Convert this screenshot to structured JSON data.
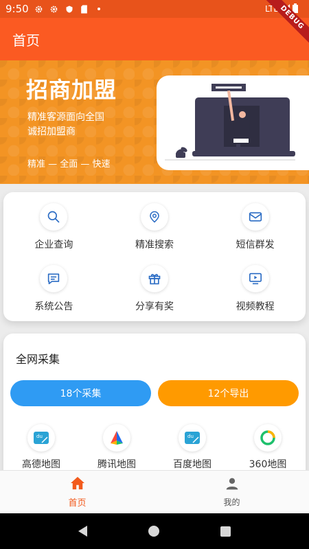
{
  "status_bar": {
    "time": "9:50",
    "network": "LTE",
    "icons": [
      "gear-icon",
      "gear-icon",
      "shield-icon",
      "sd-card-icon",
      "dot-icon",
      "signal-icon",
      "battery-icon"
    ]
  },
  "app_bar": {
    "title": "首页",
    "debug_label": "DEBUG"
  },
  "banner": {
    "headline": "招商加盟",
    "subline1": "精准客源面向全国",
    "subline2": "诚招加盟商",
    "slogan": "精准 — 全面 — 快速"
  },
  "quick_actions": [
    {
      "label": "企业查询",
      "icon": "search-icon"
    },
    {
      "label": "精准搜索",
      "icon": "location-pin-icon"
    },
    {
      "label": "短信群发",
      "icon": "mail-icon"
    },
    {
      "label": "系统公告",
      "icon": "chat-icon"
    },
    {
      "label": "分享有奖",
      "icon": "gift-icon"
    },
    {
      "label": "视频教程",
      "icon": "video-icon"
    }
  ],
  "collection": {
    "title": "全网采集",
    "collect_button": "18个采集",
    "export_button": "12个导出",
    "sources": [
      {
        "label": "高德地图",
        "icon": "amap-icon"
      },
      {
        "label": "腾讯地图",
        "icon": "tencent-map-icon"
      },
      {
        "label": "百度地图",
        "icon": "baidu-map-icon"
      },
      {
        "label": "360地图",
        "icon": "360-map-icon"
      }
    ]
  },
  "bottom_nav": {
    "home": "首页",
    "mine": "我的"
  },
  "colors": {
    "primary": "#fb5a22",
    "banner": "#f39424",
    "blue_button": "#2f9bf3",
    "orange_button": "#ff9a00",
    "icon_blue": "#2b6cc4"
  }
}
